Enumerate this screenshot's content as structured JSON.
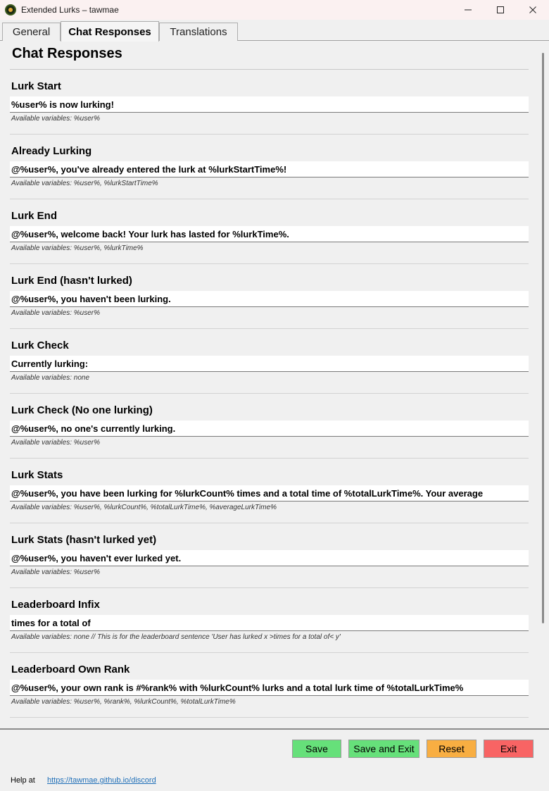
{
  "window": {
    "title": "Extended Lurks – tawmae",
    "app_icon": "app-logo-icon",
    "controls": [
      "minimize-icon",
      "maximize-icon",
      "close-icon"
    ]
  },
  "tabs": [
    {
      "label": "General",
      "active": false
    },
    {
      "label": "Chat Responses",
      "active": true
    },
    {
      "label": "Translations",
      "active": false
    }
  ],
  "page": {
    "title": "Chat Responses",
    "fields": [
      {
        "label": "Lurk Start",
        "value": "%user% is now lurking!",
        "help": "Available variables: %user%"
      },
      {
        "label": "Already Lurking",
        "value": "@%user%, you've already entered the lurk at %lurkStartTime%!",
        "help": "Available variables: %user%, %lurkStartTime%"
      },
      {
        "label": "Lurk End",
        "value": "@%user%, welcome back! Your lurk has lasted for %lurkTime%.",
        "help": "Available variables: %user%, %lurkTime%"
      },
      {
        "label": "Lurk End (hasn't lurked)",
        "value": "@%user%, you haven't been lurking.",
        "help": "Available variables: %user%"
      },
      {
        "label": "Lurk Check",
        "value": "Currently lurking:",
        "help": "Available variables: none"
      },
      {
        "label": "Lurk Check (No one lurking)",
        "value": "@%user%, no one's currently lurking.",
        "help": "Available variables: %user%"
      },
      {
        "label": "Lurk Stats",
        "value": "@%user%, you have been lurking for %lurkCount% times and a total time of %totalLurkTime%. Your average",
        "help": "Available variables: %user%, %lurkCount%, %totalLurkTime%, %averageLurkTime%"
      },
      {
        "label": "Lurk Stats (hasn't lurked yet)",
        "value": "@%user%, you haven't ever lurked yet.",
        "help": "Available variables: %user%"
      },
      {
        "label": "Leaderboard Infix",
        "value": "times for a total of",
        "help": "Available variables: none // This is for the leaderboard sentence 'User has lurked x >times for a total of< y'"
      },
      {
        "label": "Leaderboard Own Rank",
        "value": "@%user%, your own rank is #%rank% with %lurkCount% lurks and a total lurk time of %totalLurkTime%",
        "help": "Available variables: %user%, %rank%, %lurkCount%, %totalLurkTime%"
      }
    ]
  },
  "buttons": {
    "save": "Save",
    "save_exit": "Save and Exit",
    "reset": "Reset",
    "exit": "Exit"
  },
  "footer": {
    "help_label": "Help at",
    "help_link": "https://tawmae.github.io/discord"
  },
  "colors": {
    "save": "#66e07a",
    "reset": "#f8ae42",
    "exit": "#f86464",
    "link": "#1f6fb8"
  }
}
